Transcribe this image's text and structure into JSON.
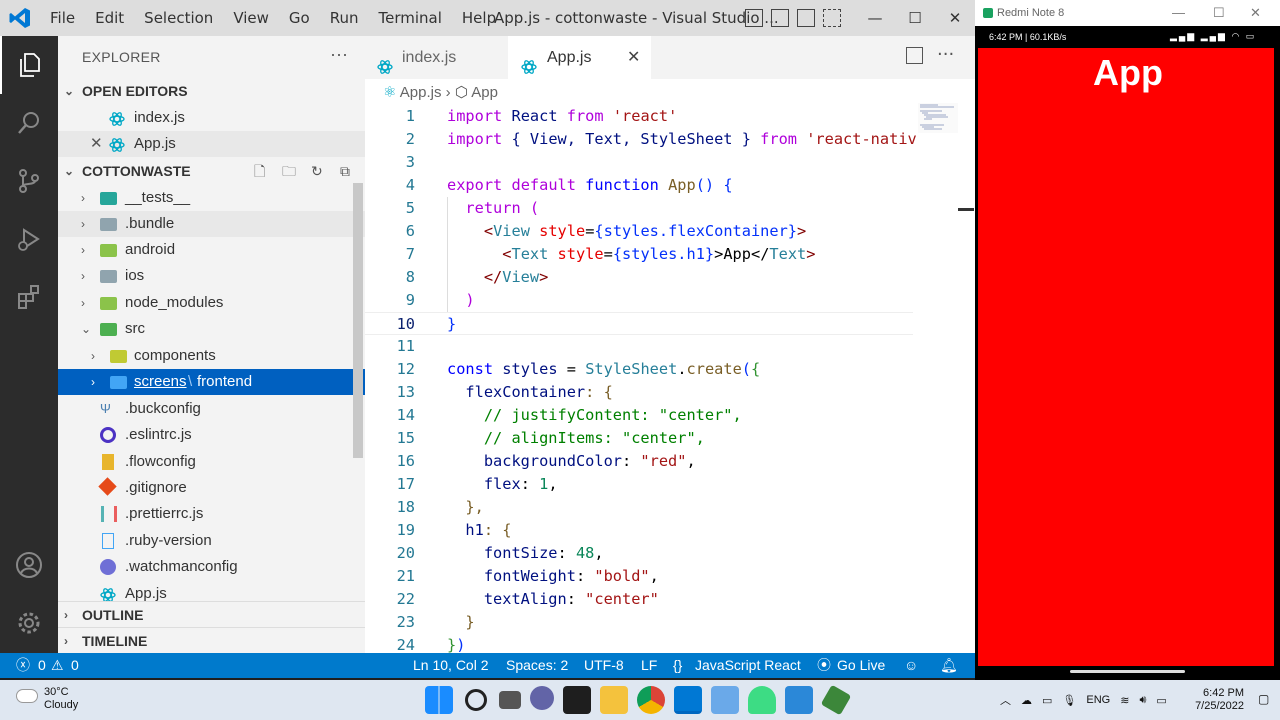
{
  "titlebar": {
    "menu": [
      "File",
      "Edit",
      "Selection",
      "View",
      "Go",
      "Run",
      "Terminal",
      "Help"
    ],
    "title": "App.js - cottonwaste - Visual Studio ...",
    "controls": [
      "—",
      "☐",
      "✕"
    ]
  },
  "sidebar": {
    "header": "EXPLORER",
    "more": "···",
    "open_editors_title": "OPEN EDITORS",
    "open_editors": [
      "index.js",
      "App.js"
    ],
    "project_title": "COTTONWASTE",
    "tree": [
      "__tests__",
      ".bundle",
      "android",
      "ios",
      "node_modules",
      "src",
      "components",
      "screens",
      "frontend",
      ".buckconfig",
      ".eslintrc.js",
      ".flowconfig",
      ".gitignore",
      ".prettierrc.js",
      ".ruby-version",
      ".watchmanconfig",
      "App.js"
    ],
    "path_separator": "\\",
    "outline": "OUTLINE",
    "timeline": "TIMELINE"
  },
  "tabs": [
    {
      "label": "index.js"
    },
    {
      "label": "App.js",
      "close": "✕"
    }
  ],
  "breadcrumb": {
    "file": "App.js",
    "sep": "›",
    "symbol": "App"
  },
  "code": {
    "line_numbers": [
      "1",
      "2",
      "3",
      "4",
      "5",
      "6",
      "7",
      "8",
      "9",
      "10",
      "11",
      "12",
      "13",
      "14",
      "15",
      "16",
      "17",
      "18",
      "19",
      "20",
      "21",
      "22",
      "23",
      "24"
    ],
    "l1": [
      "import",
      "React",
      "from",
      "'react'"
    ],
    "l2": [
      "import",
      "{ View, Text, StyleSheet }",
      "from",
      "'react-nativ"
    ],
    "l4": [
      "export",
      "default",
      "function",
      "App",
      "() {"
    ],
    "l5": [
      "return",
      "("
    ],
    "l6": [
      "<",
      "View",
      "style",
      "=",
      "{styles.flexContainer}",
      ">"
    ],
    "l7": [
      "<",
      "Text",
      "style",
      "=",
      "{styles.h1}",
      ">App</",
      "Text",
      ">"
    ],
    "l8": [
      "</",
      "View",
      ">"
    ],
    "l9": [
      ")"
    ],
    "l10": [
      "}"
    ],
    "l12": [
      "const",
      "styles",
      "=",
      "StyleSheet",
      ".",
      "create",
      "(",
      "{"
    ],
    "l13": [
      "flexContainer",
      ": {"
    ],
    "l14": "// justifyContent: \"center\",",
    "l15": "// alignItems: \"center\",",
    "l16": [
      "backgroundColor",
      ": ",
      "\"red\"",
      ","
    ],
    "l17": [
      "flex",
      ": ",
      "1",
      ","
    ],
    "l18": "},",
    "l19": [
      "h1",
      ": {"
    ],
    "l20": [
      "fontSize",
      ": ",
      "48",
      ","
    ],
    "l21": [
      "fontWeight",
      ": ",
      "\"bold\"",
      ","
    ],
    "l22": [
      "textAlign",
      ": ",
      "\"center\""
    ],
    "l23": "}",
    "l24": [
      "}",
      ")"
    ]
  },
  "status": {
    "errors": "0",
    "warnings": "0",
    "position": "Ln 10, Col 2",
    "spaces": "Spaces: 2",
    "encoding": "UTF-8",
    "eol": "LF",
    "language": "JavaScript React",
    "golive": "Go Live"
  },
  "phone": {
    "window_title": "Redmi Note 8",
    "status_left": "6:42 PM | 60.1KB/s",
    "app_text": "App",
    "bg_color": "#ff0000"
  },
  "taskbar": {
    "temp": "30°C",
    "condition": "Cloudy",
    "lang": "ENG",
    "time": "6:42 PM",
    "date": "7/25/2022"
  }
}
